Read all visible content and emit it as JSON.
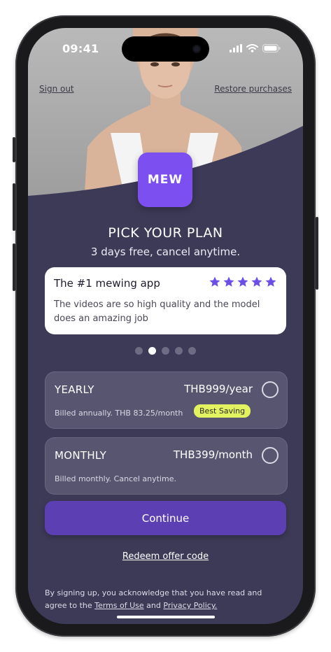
{
  "status_bar": {
    "time": "09:41"
  },
  "header": {
    "sign_out": "Sign out",
    "restore": "Restore purchases"
  },
  "logo": {
    "text": "MEW",
    "color": "#7b4ff0"
  },
  "headline": {
    "title": "PICK YOUR PLAN",
    "subtitle": "3 days free, cancel anytime."
  },
  "review": {
    "title": "The #1 mewing app",
    "stars": 5,
    "text": "The videos are so high quality and the model does an amazing job"
  },
  "carousel": {
    "total": 5,
    "active_index": 1
  },
  "plans": [
    {
      "name": "YEARLY",
      "price": "THB999/year",
      "note": "Billed annually. THB 83.25/month",
      "badge": "Best Saving",
      "selected": false
    },
    {
      "name": "MONTHLY",
      "price": "THB399/month",
      "note": "Billed monthly. Cancel anytime.",
      "selected": false
    }
  ],
  "actions": {
    "continue": "Continue",
    "redeem": "Redeem offer code"
  },
  "legal": {
    "prefix": "By signing up, you acknowledge that you have read and agree to the ",
    "terms": "Terms of Use",
    "middle": " and ",
    "privacy": "Privacy Policy."
  },
  "colors": {
    "accent": "#7b4ff0",
    "background": "#3d3a57",
    "badge": "#e3f35f",
    "star": "#6b4ee8"
  }
}
